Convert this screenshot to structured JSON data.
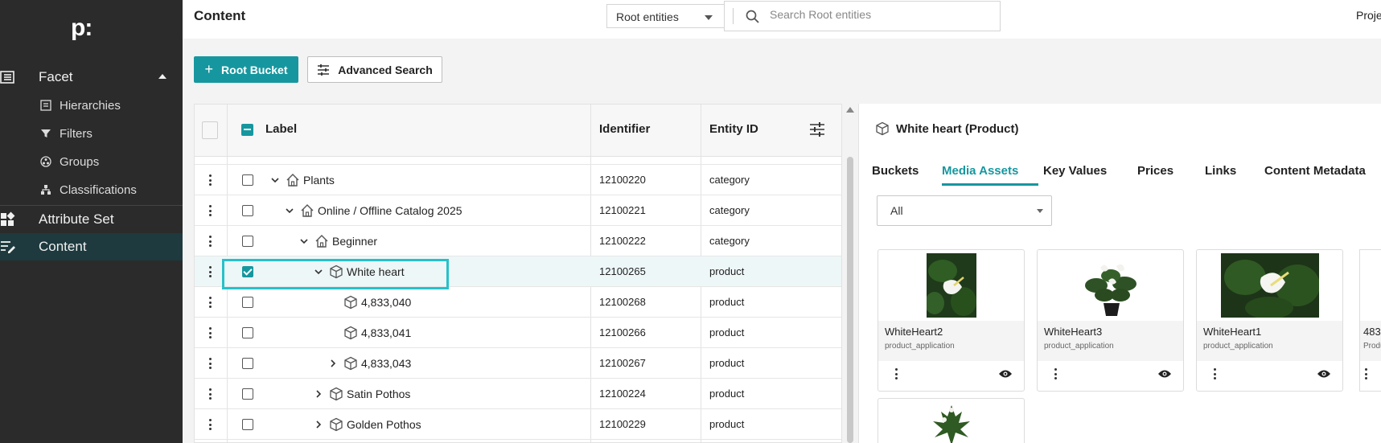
{
  "sidebar": {
    "logo": "p:",
    "facet": {
      "label": "Facet",
      "icon": "facet-icon"
    },
    "sub_items": [
      {
        "label": "Hierarchies",
        "icon": "hierarchy-icon"
      },
      {
        "label": "Filters",
        "icon": "filter-icon"
      },
      {
        "label": "Groups",
        "icon": "groups-icon"
      },
      {
        "label": "Classifications",
        "icon": "classification-icon"
      }
    ],
    "attribute_set": {
      "label": "Attribute Set",
      "icon": "grid-icon"
    },
    "content": {
      "label": "Content",
      "icon": "edit-list-icon"
    }
  },
  "header": {
    "title": "Content",
    "entity_select": "Root entities",
    "search_placeholder": "Search Root entities",
    "project": "Proje"
  },
  "actions": {
    "root_bucket": "Root Bucket",
    "advanced_search": "Advanced Search"
  },
  "table": {
    "columns": {
      "label": "Label",
      "identifier": "Identifier",
      "entity_id": "Entity ID"
    },
    "rows": [
      {
        "label": "Plants",
        "identifier": "12100220",
        "entity": "category"
      },
      {
        "label": "Online / Offline Catalog 2025",
        "identifier": "12100221",
        "entity": "category"
      },
      {
        "label": "Beginner",
        "identifier": "12100222",
        "entity": "category"
      },
      {
        "label": "White heart",
        "identifier": "12100265",
        "entity": "product"
      },
      {
        "label": "4,833,040",
        "identifier": "12100268",
        "entity": "product"
      },
      {
        "label": "4,833,041",
        "identifier": "12100266",
        "entity": "product"
      },
      {
        "label": "4,833,043",
        "identifier": "12100267",
        "entity": "product"
      },
      {
        "label": "Satin Pothos",
        "identifier": "12100224",
        "entity": "product"
      },
      {
        "label": "Golden Pothos",
        "identifier": "12100229",
        "entity": "product"
      }
    ]
  },
  "detail": {
    "title": "White heart (Product)",
    "tabs": [
      "Buckets",
      "Media Assets",
      "Key Values",
      "Prices",
      "Links",
      "Content Metadata"
    ],
    "filter": "All",
    "assets": [
      {
        "name": "WhiteHeart2",
        "type": "product_application"
      },
      {
        "name": "WhiteHeart3",
        "type": "product_application"
      },
      {
        "name": "WhiteHeart1",
        "type": "product_application"
      }
    ],
    "partial_asset": {
      "name": "483",
      "type": "Produ"
    }
  },
  "colors": {
    "accent": "#16979f",
    "highlight": "#27c1c9",
    "sidebar": "#2b2b2b"
  }
}
